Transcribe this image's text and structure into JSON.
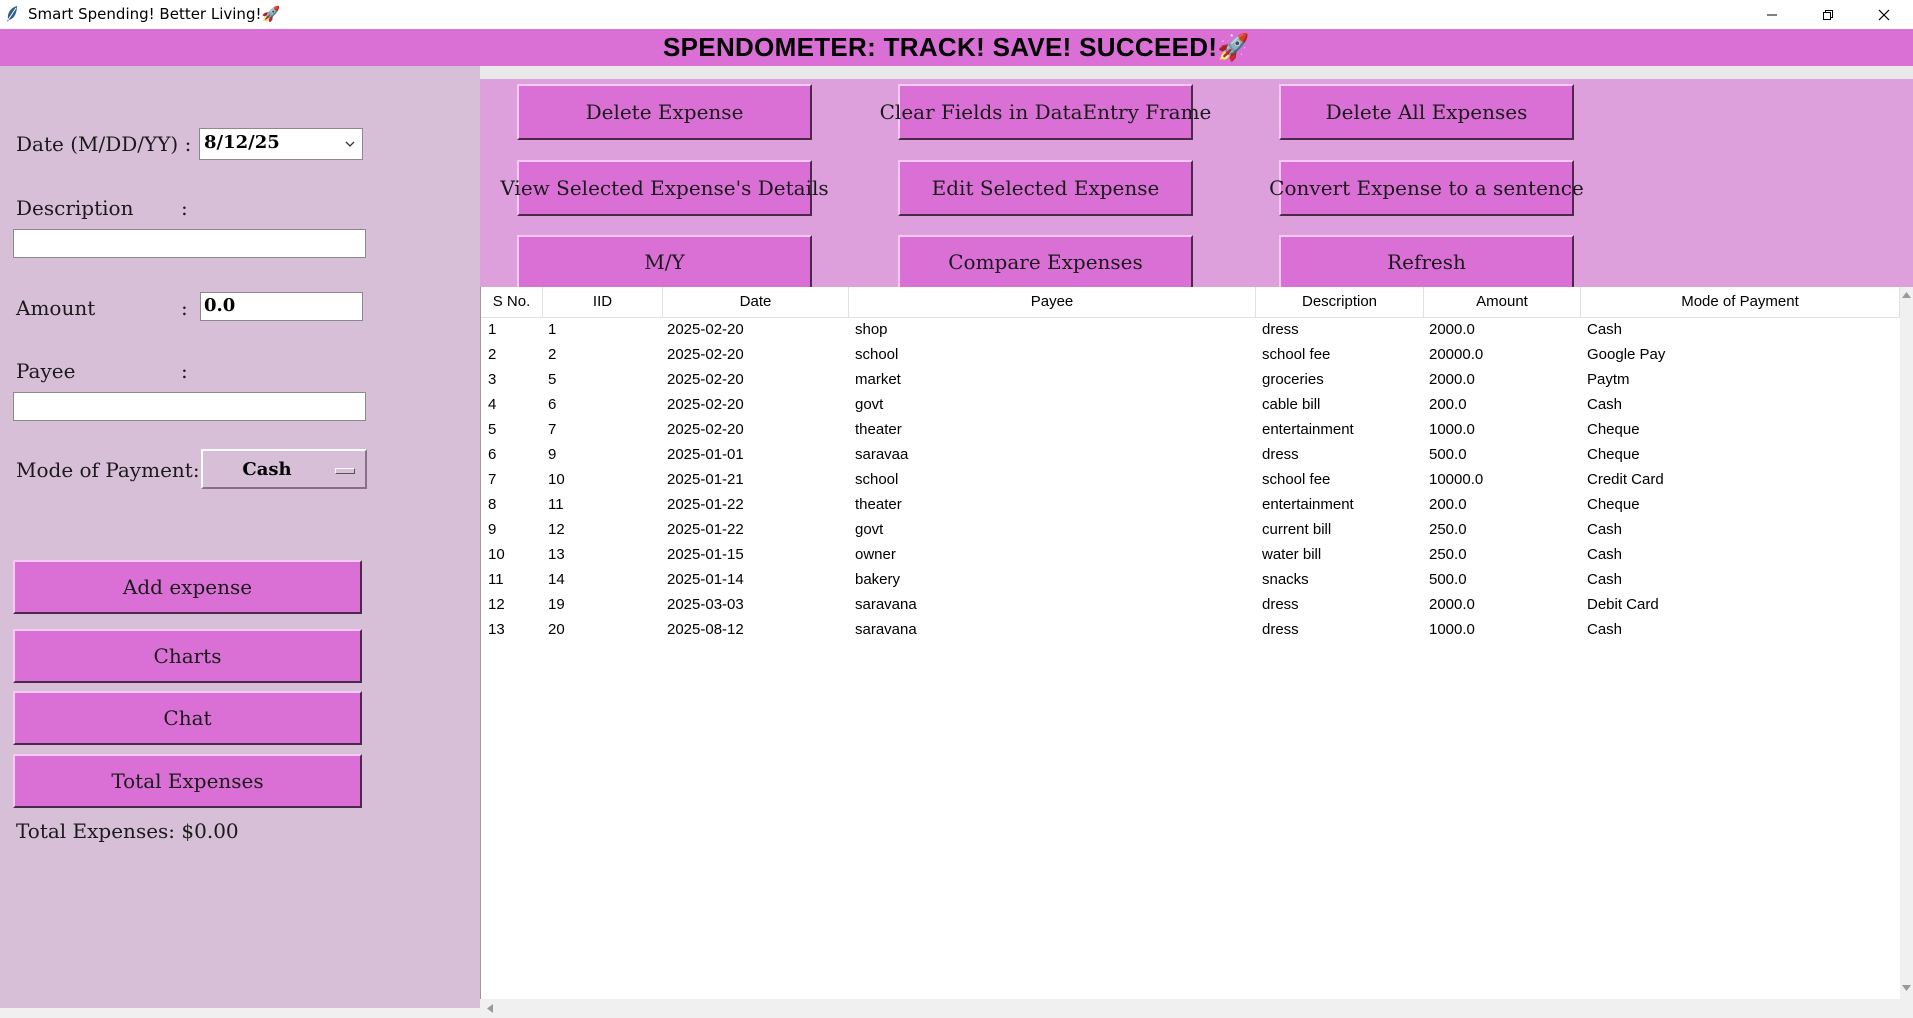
{
  "window": {
    "title": "Smart Spending! Better Living!🚀",
    "controls": [
      "minimize-icon",
      "restore-icon",
      "close-icon"
    ]
  },
  "banner": {
    "text": "SPENDOMETER: TRACK! SAVE! SUCCEED!🚀"
  },
  "form": {
    "date_label": "Date (M/DD/YY) :",
    "date_value": "8/12/25",
    "description_label": "Description",
    "description_value": "",
    "amount_label": "Amount",
    "amount_value": "0.0",
    "payee_label": "Payee",
    "payee_value": "",
    "mode_label": "Mode of Payment:",
    "mode_value": "Cash",
    "colon": ":"
  },
  "left_buttons": {
    "add": "Add expense",
    "charts": "Charts",
    "chat": "Chat",
    "total": "Total Expenses"
  },
  "total_text": "Total Expenses: $0.00",
  "action_buttons": {
    "delete": "Delete Expense",
    "clear": "Clear Fields in DataEntry Frame",
    "delete_all": "Delete All Expenses",
    "view": "View Selected Expense's Details",
    "edit": "Edit Selected Expense",
    "convert": "Convert Expense to a sentence",
    "my": "M/Y",
    "compare": "Compare Expenses",
    "refresh": "Refresh"
  },
  "table": {
    "columns": [
      "S No.",
      "IID",
      "Date",
      "Payee",
      "Description",
      "Amount",
      "Mode of Payment"
    ],
    "rows": [
      [
        "1",
        "1",
        "2025-02-20",
        "shop",
        "dress",
        "2000.0",
        "Cash"
      ],
      [
        "2",
        "2",
        "2025-02-20",
        "school",
        "school fee",
        "20000.0",
        "Google Pay"
      ],
      [
        "3",
        "5",
        "2025-02-20",
        "market",
        "groceries",
        "2000.0",
        "Paytm"
      ],
      [
        "4",
        "6",
        "2025-02-20",
        "govt",
        "cable bill",
        "200.0",
        "Cash"
      ],
      [
        "5",
        "7",
        "2025-02-20",
        "theater",
        "entertainment",
        "1000.0",
        "Cheque"
      ],
      [
        "6",
        "9",
        "2025-01-01",
        "saravaa",
        "dress",
        "500.0",
        "Cheque"
      ],
      [
        "7",
        "10",
        "2025-01-21",
        "school",
        "school fee",
        "10000.0",
        "Credit Card"
      ],
      [
        "8",
        "11",
        "2025-01-22",
        "theater",
        "entertainment",
        "200.0",
        "Cheque"
      ],
      [
        "9",
        "12",
        "2025-01-22",
        "govt",
        "current bill",
        "250.0",
        "Cash"
      ],
      [
        "10",
        "13",
        "2025-01-15",
        "owner",
        "water bill",
        "250.0",
        "Cash"
      ],
      [
        "11",
        "14",
        "2025-01-14",
        "bakery",
        "snacks",
        "500.0",
        "Cash"
      ],
      [
        "12",
        "19",
        "2025-03-03",
        "saravana",
        "dress",
        "2000.0",
        "Debit Card"
      ],
      [
        "13",
        "20",
        "2025-08-12",
        "saravana",
        "dress",
        "1000.0",
        "Cash"
      ]
    ]
  },
  "colors": {
    "banner": "#da70d6",
    "left_panel": "#d8bfd8",
    "button_area": "#dda0dd",
    "button": "#da70d6"
  }
}
